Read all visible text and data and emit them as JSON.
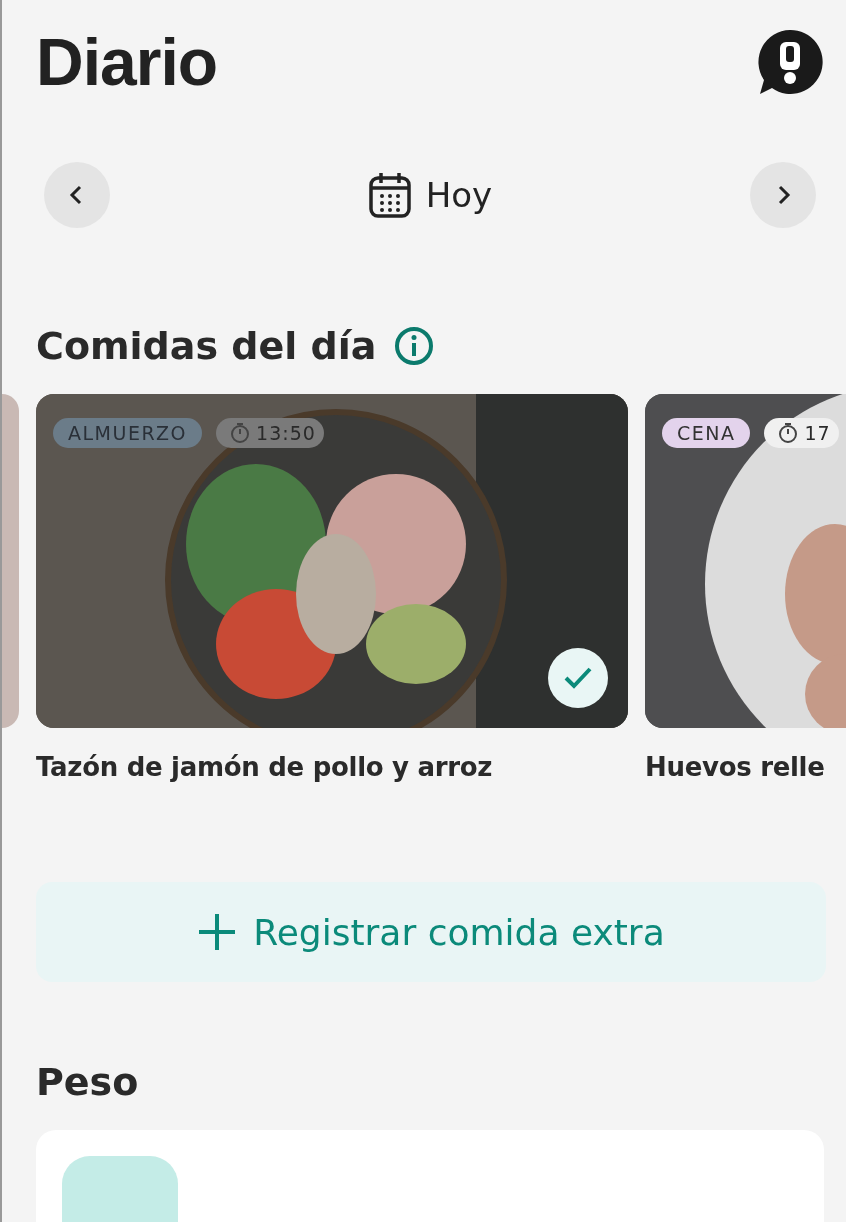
{
  "header": {
    "title": "Diario"
  },
  "date_nav": {
    "label": "Hoy"
  },
  "meals_section": {
    "title": "Comidas del día"
  },
  "meals": [
    {
      "kind": "partial"
    },
    {
      "kind": "card",
      "tag": "ALMUERZO",
      "color": "#6b7c89",
      "time": "13:50",
      "done": true,
      "title": "Tazón de jamón de pollo y arroz"
    },
    {
      "kind": "card",
      "tag": "CENA",
      "color": "#e3d3ec",
      "time": "17",
      "done": false,
      "title": "Huevos relle"
    }
  ],
  "extra_button": {
    "label": "Registrar comida extra"
  },
  "weight_section": {
    "title": "Peso"
  }
}
